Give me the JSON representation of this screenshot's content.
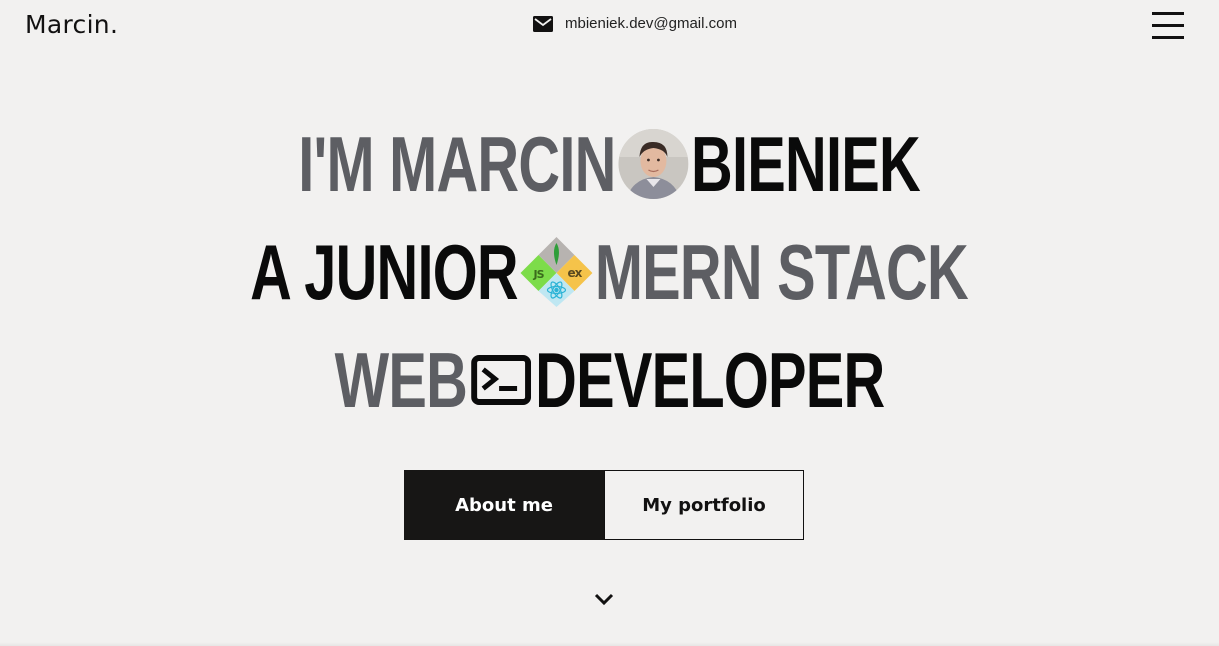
{
  "header": {
    "logo": "Marcin.",
    "email": "mbieniek.dev@gmail.com",
    "email_icon": "mail-icon",
    "menu_icon": "hamburger-menu-icon"
  },
  "hero": {
    "line1": {
      "part1": "I'M MARCIN",
      "part2": "BIENIEK",
      "icon": "profile-photo"
    },
    "line2": {
      "part1": "A JUNIOR",
      "part2": "MERN STACK",
      "icon": "mern-logos-icon",
      "logo_text": {
        "node": "JS",
        "express": "ex"
      }
    },
    "line3": {
      "part1": "WEB",
      "part2": "DEVELOPER",
      "icon": "terminal-icon"
    }
  },
  "buttons": {
    "about": "About me",
    "portfolio": "My portfolio"
  },
  "scroll_icon": "chevron-down-icon",
  "colors": {
    "background": "#f2f1f0",
    "text_dark": "#121111",
    "text_grey": "#5d5e63",
    "button_dark": "#171615"
  }
}
